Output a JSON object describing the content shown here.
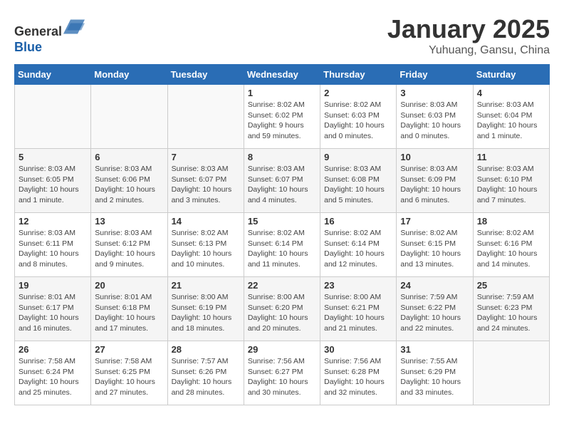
{
  "header": {
    "logo_line1": "General",
    "logo_line2": "Blue",
    "title": "January 2025",
    "subtitle": "Yuhuang, Gansu, China"
  },
  "days_of_week": [
    "Sunday",
    "Monday",
    "Tuesday",
    "Wednesday",
    "Thursday",
    "Friday",
    "Saturday"
  ],
  "weeks": [
    [
      {
        "day": "",
        "info": ""
      },
      {
        "day": "",
        "info": ""
      },
      {
        "day": "",
        "info": ""
      },
      {
        "day": "1",
        "info": "Sunrise: 8:02 AM\nSunset: 6:02 PM\nDaylight: 9 hours\nand 59 minutes."
      },
      {
        "day": "2",
        "info": "Sunrise: 8:02 AM\nSunset: 6:03 PM\nDaylight: 10 hours\nand 0 minutes."
      },
      {
        "day": "3",
        "info": "Sunrise: 8:03 AM\nSunset: 6:03 PM\nDaylight: 10 hours\nand 0 minutes."
      },
      {
        "day": "4",
        "info": "Sunrise: 8:03 AM\nSunset: 6:04 PM\nDaylight: 10 hours\nand 1 minute."
      }
    ],
    [
      {
        "day": "5",
        "info": "Sunrise: 8:03 AM\nSunset: 6:05 PM\nDaylight: 10 hours\nand 1 minute."
      },
      {
        "day": "6",
        "info": "Sunrise: 8:03 AM\nSunset: 6:06 PM\nDaylight: 10 hours\nand 2 minutes."
      },
      {
        "day": "7",
        "info": "Sunrise: 8:03 AM\nSunset: 6:07 PM\nDaylight: 10 hours\nand 3 minutes."
      },
      {
        "day": "8",
        "info": "Sunrise: 8:03 AM\nSunset: 6:07 PM\nDaylight: 10 hours\nand 4 minutes."
      },
      {
        "day": "9",
        "info": "Sunrise: 8:03 AM\nSunset: 6:08 PM\nDaylight: 10 hours\nand 5 minutes."
      },
      {
        "day": "10",
        "info": "Sunrise: 8:03 AM\nSunset: 6:09 PM\nDaylight: 10 hours\nand 6 minutes."
      },
      {
        "day": "11",
        "info": "Sunrise: 8:03 AM\nSunset: 6:10 PM\nDaylight: 10 hours\nand 7 minutes."
      }
    ],
    [
      {
        "day": "12",
        "info": "Sunrise: 8:03 AM\nSunset: 6:11 PM\nDaylight: 10 hours\nand 8 minutes."
      },
      {
        "day": "13",
        "info": "Sunrise: 8:03 AM\nSunset: 6:12 PM\nDaylight: 10 hours\nand 9 minutes."
      },
      {
        "day": "14",
        "info": "Sunrise: 8:02 AM\nSunset: 6:13 PM\nDaylight: 10 hours\nand 10 minutes."
      },
      {
        "day": "15",
        "info": "Sunrise: 8:02 AM\nSunset: 6:14 PM\nDaylight: 10 hours\nand 11 minutes."
      },
      {
        "day": "16",
        "info": "Sunrise: 8:02 AM\nSunset: 6:14 PM\nDaylight: 10 hours\nand 12 minutes."
      },
      {
        "day": "17",
        "info": "Sunrise: 8:02 AM\nSunset: 6:15 PM\nDaylight: 10 hours\nand 13 minutes."
      },
      {
        "day": "18",
        "info": "Sunrise: 8:02 AM\nSunset: 6:16 PM\nDaylight: 10 hours\nand 14 minutes."
      }
    ],
    [
      {
        "day": "19",
        "info": "Sunrise: 8:01 AM\nSunset: 6:17 PM\nDaylight: 10 hours\nand 16 minutes."
      },
      {
        "day": "20",
        "info": "Sunrise: 8:01 AM\nSunset: 6:18 PM\nDaylight: 10 hours\nand 17 minutes."
      },
      {
        "day": "21",
        "info": "Sunrise: 8:00 AM\nSunset: 6:19 PM\nDaylight: 10 hours\nand 18 minutes."
      },
      {
        "day": "22",
        "info": "Sunrise: 8:00 AM\nSunset: 6:20 PM\nDaylight: 10 hours\nand 20 minutes."
      },
      {
        "day": "23",
        "info": "Sunrise: 8:00 AM\nSunset: 6:21 PM\nDaylight: 10 hours\nand 21 minutes."
      },
      {
        "day": "24",
        "info": "Sunrise: 7:59 AM\nSunset: 6:22 PM\nDaylight: 10 hours\nand 22 minutes."
      },
      {
        "day": "25",
        "info": "Sunrise: 7:59 AM\nSunset: 6:23 PM\nDaylight: 10 hours\nand 24 minutes."
      }
    ],
    [
      {
        "day": "26",
        "info": "Sunrise: 7:58 AM\nSunset: 6:24 PM\nDaylight: 10 hours\nand 25 minutes."
      },
      {
        "day": "27",
        "info": "Sunrise: 7:58 AM\nSunset: 6:25 PM\nDaylight: 10 hours\nand 27 minutes."
      },
      {
        "day": "28",
        "info": "Sunrise: 7:57 AM\nSunset: 6:26 PM\nDaylight: 10 hours\nand 28 minutes."
      },
      {
        "day": "29",
        "info": "Sunrise: 7:56 AM\nSunset: 6:27 PM\nDaylight: 10 hours\nand 30 minutes."
      },
      {
        "day": "30",
        "info": "Sunrise: 7:56 AM\nSunset: 6:28 PM\nDaylight: 10 hours\nand 32 minutes."
      },
      {
        "day": "31",
        "info": "Sunrise: 7:55 AM\nSunset: 6:29 PM\nDaylight: 10 hours\nand 33 minutes."
      },
      {
        "day": "",
        "info": ""
      }
    ]
  ]
}
